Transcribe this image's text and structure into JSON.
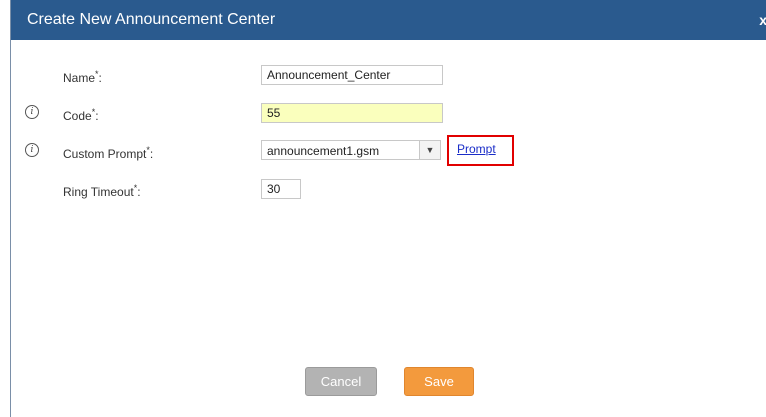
{
  "dialog": {
    "title": "Create New Announcement Center",
    "close_label": "x"
  },
  "form": {
    "name": {
      "label": "Name",
      "required_mark": "*",
      "colon": ":",
      "value": "Announcement_Center"
    },
    "code": {
      "label": "Code",
      "required_mark": "*",
      "colon": ":",
      "value": "55",
      "info_icon": "info-icon"
    },
    "custom_prompt": {
      "label": "Custom Prompt",
      "required_mark": "*",
      "colon": ":",
      "value": "announcement1.gsm",
      "link_label": "Prompt",
      "info_icon": "info-icon"
    },
    "ring_timeout": {
      "label": "Ring Timeout",
      "required_mark": "*",
      "colon": ":",
      "value": "30"
    }
  },
  "buttons": {
    "cancel_label": "Cancel",
    "save_label": "Save"
  },
  "colors": {
    "titlebar": "#2a5a8e",
    "save_button": "#f39a3d",
    "cancel_button": "#b3b3b3",
    "highlight_box": "#e10000"
  }
}
